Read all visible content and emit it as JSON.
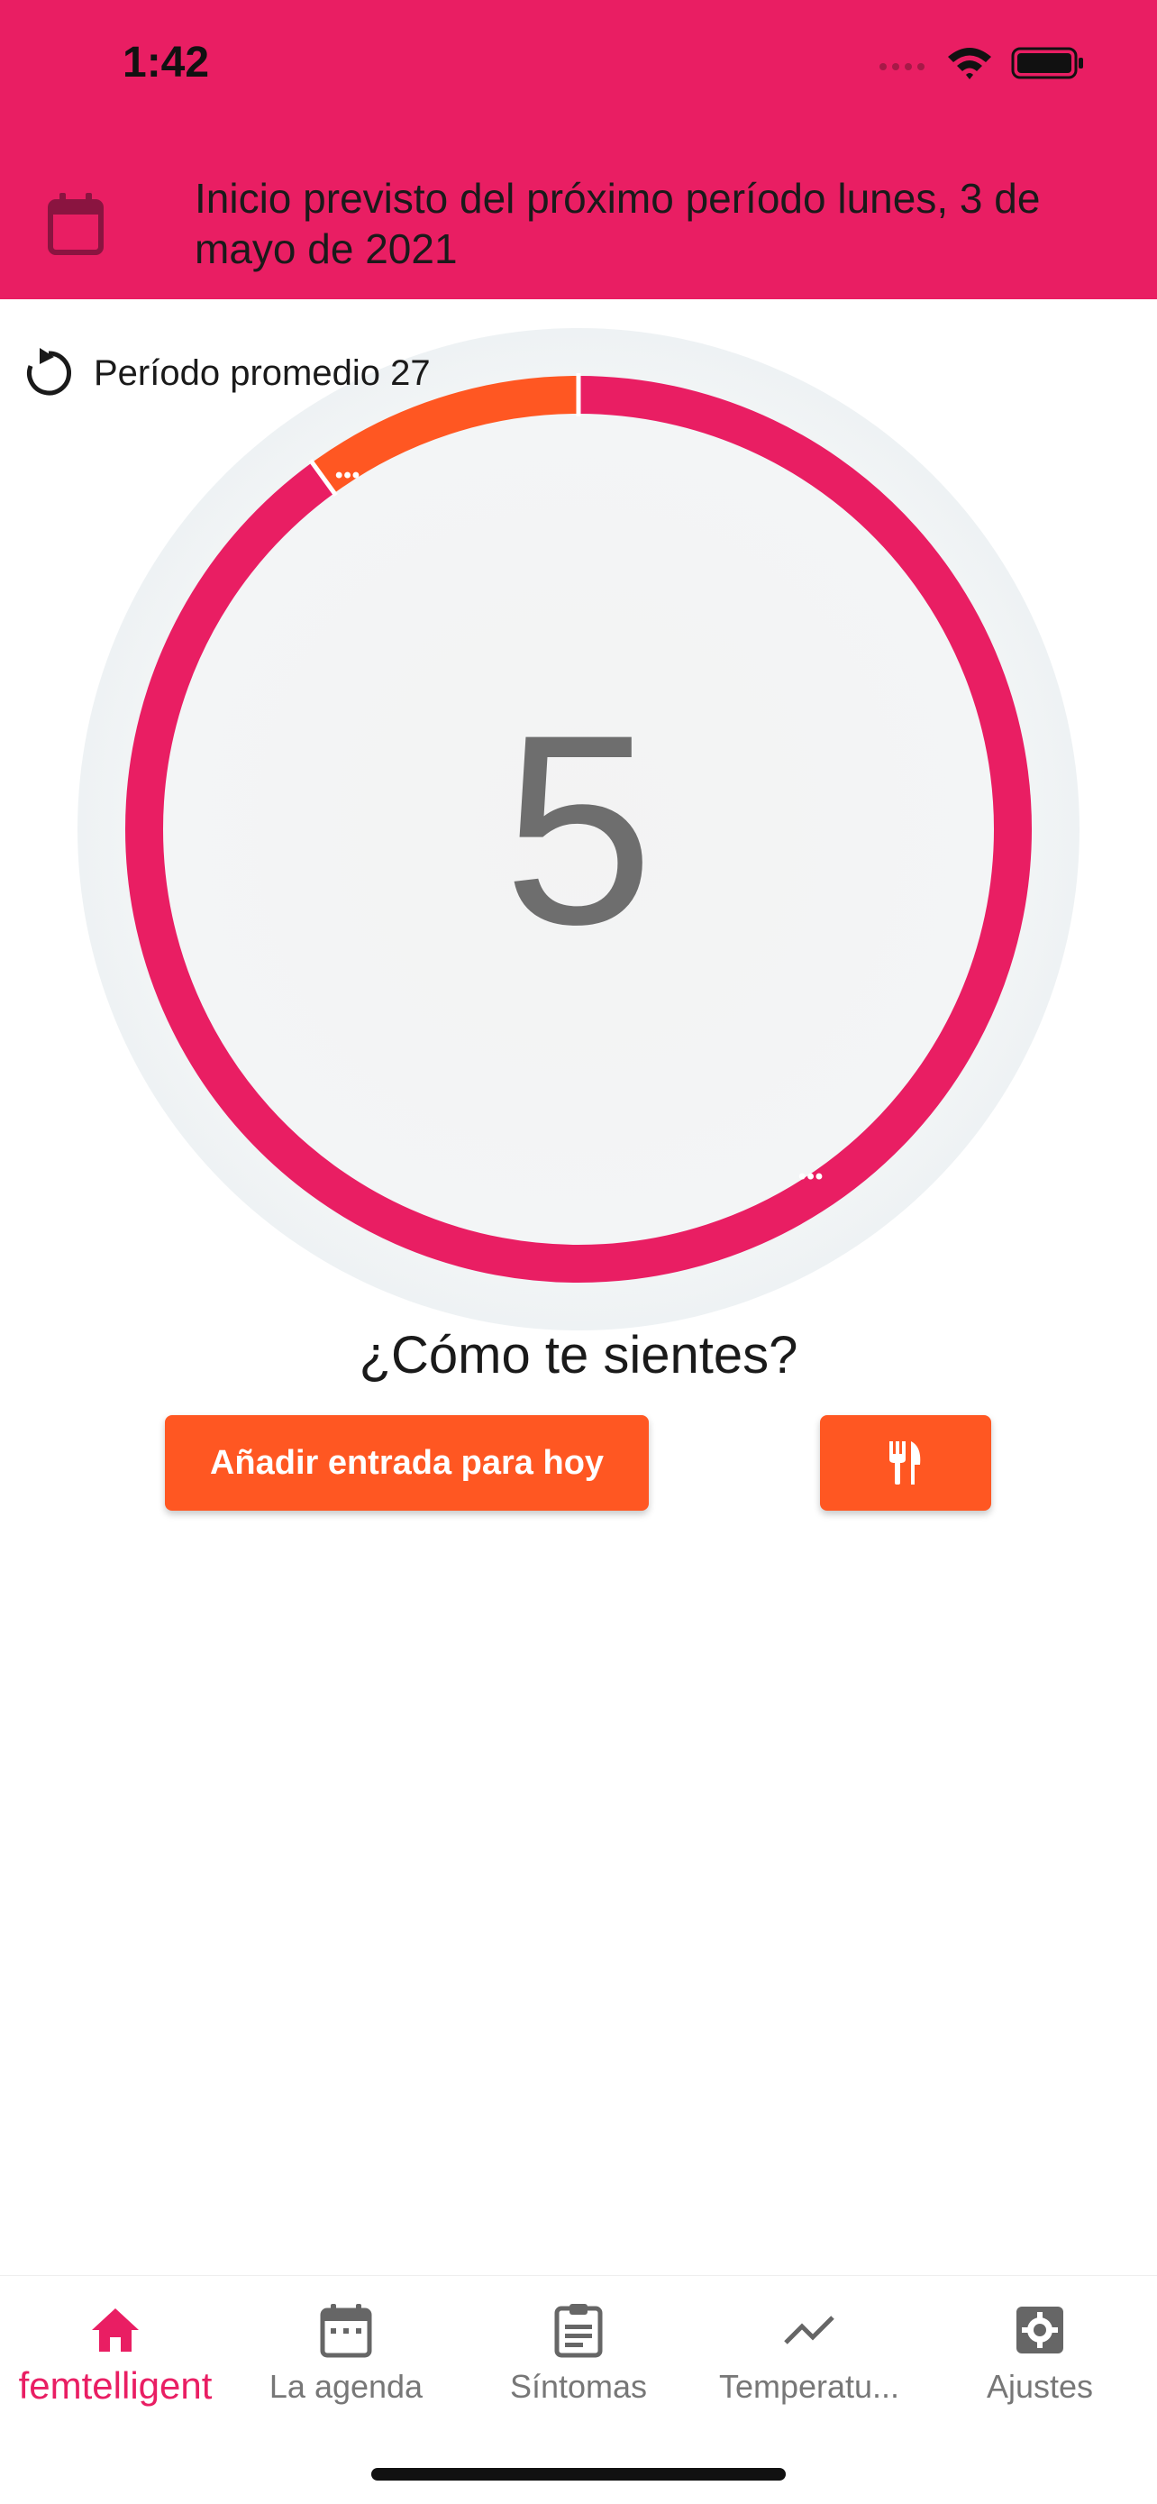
{
  "status_bar": {
    "time": "1:42"
  },
  "header": {
    "icon": "calendar-icon",
    "next_period_text": "Inicio previsto del próximo período lunes, 3 de mayo de 2021"
  },
  "average_period": {
    "icon": "history-icon",
    "label": "Período promedio 27"
  },
  "cycle": {
    "current_day": "5",
    "colors": {
      "period": "#FF5722",
      "cycle": "#E91E63",
      "background": "#F4F5F6"
    },
    "period_fraction": 0.1
  },
  "question": "¿Cómo te sientes?",
  "buttons": {
    "add_entry": "Añadir entrada para hoy",
    "food_icon": "restaurant-icon"
  },
  "bottom_nav": {
    "items": [
      {
        "label": "femtelligent",
        "icon": "home-icon",
        "active": true
      },
      {
        "label": "La agenda",
        "icon": "calendar-icon",
        "active": false
      },
      {
        "label": "Síntomas",
        "icon": "clipboard-icon",
        "active": false
      },
      {
        "label": "Temperatu...",
        "icon": "trend-icon",
        "active": false
      },
      {
        "label": "Ajustes",
        "icon": "settings-icon",
        "active": false
      }
    ]
  },
  "colors": {
    "primary": "#E91E63",
    "accent": "#FF5722",
    "inactive": "#777777"
  }
}
